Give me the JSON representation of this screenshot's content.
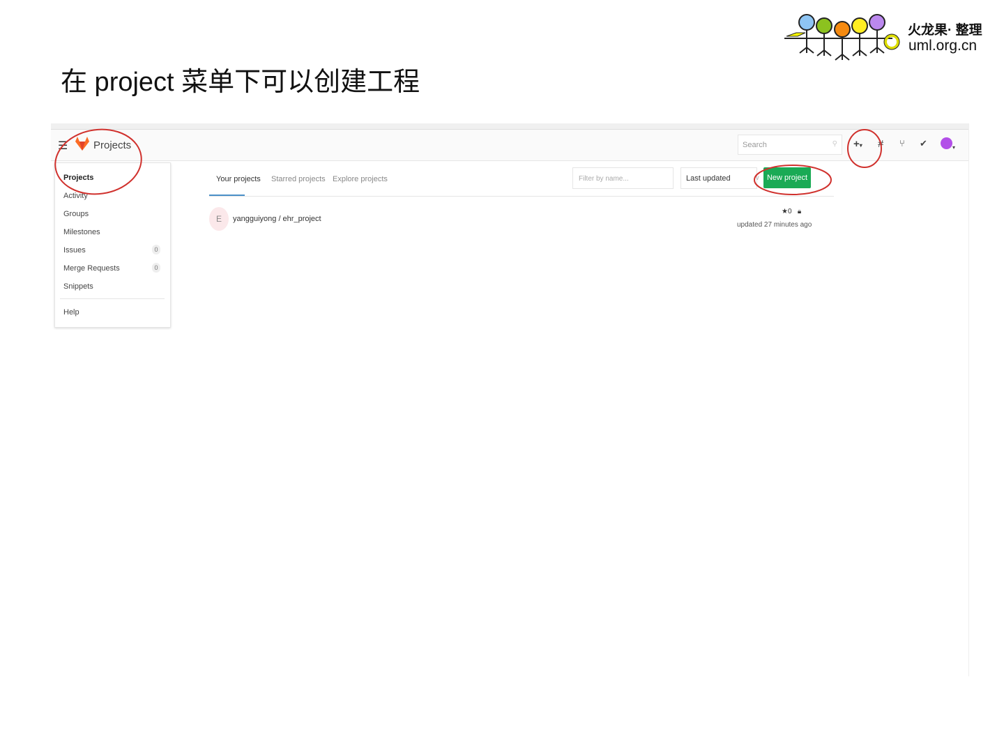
{
  "slide": {
    "title": "在 project 菜单下可以创建工程",
    "logo_line1": "火龙果· 整理",
    "logo_line2": "uml.org.cn"
  },
  "navbar": {
    "title": "Projects",
    "search_placeholder": "Search"
  },
  "menu": {
    "items": [
      {
        "label": "Projects"
      },
      {
        "label": "Activity"
      },
      {
        "label": "Groups"
      },
      {
        "label": "Milestones"
      },
      {
        "label": "Issues",
        "count": "0"
      },
      {
        "label": "Merge Requests",
        "count": "0"
      },
      {
        "label": "Snippets"
      }
    ],
    "help": "Help"
  },
  "tabs": [
    "Your projects",
    "Starred projects",
    "Explore projects"
  ],
  "filter_placeholder": "Filter by name...",
  "sort_value": "Last updated",
  "new_project_label": "New project",
  "projects": [
    {
      "avatar_letter": "E",
      "name": "yangguiyong / ehr_project",
      "stars": "0",
      "updated": "updated 27 minutes ago"
    }
  ],
  "colors": {
    "accent_green": "#1aaa55",
    "annotation_red": "#d0312d"
  }
}
